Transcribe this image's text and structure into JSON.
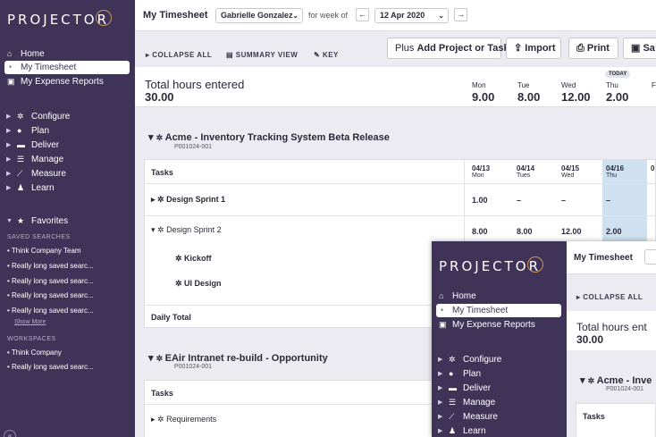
{
  "app": {
    "logo": "PROJECTOR"
  },
  "nav": {
    "home": "Home",
    "timesheet": "My Timesheet",
    "expense": "My Expense Reports",
    "configure": "Configure",
    "plan": "Plan",
    "deliver": "Deliver",
    "manage": "Manage",
    "measure": "Measure",
    "learn": "Learn",
    "favorites": "Favorites",
    "saved_searches_label": "SAVED SEARCHES",
    "saved": [
      "Think Company Team",
      "Really long saved searc...",
      "Really long saved searc...",
      "Really long saved searc...",
      "Really long saved searc...",
      "Really long saved searc..."
    ],
    "show_more": "Show More",
    "workspaces_label": "WORKSPACES",
    "workspaces": [
      "Think Company",
      "Really long saved searc..."
    ]
  },
  "header": {
    "title": "My Timesheet",
    "user": "Gabrielle Gonzalez",
    "week_label": "for week of",
    "week_value": "12 Apr 2020"
  },
  "toolbar": {
    "collapse_all": "COLLAPSE ALL",
    "summary_view": "SUMMARY VIEW",
    "key": "KEY",
    "add_prefix": "Plus",
    "add_label": "Add Project or Task",
    "import": "Import",
    "print": "Print",
    "save": "Sa"
  },
  "summary": {
    "total_label": "Total hours entered",
    "total_value": "30.00",
    "today_badge": "TODAY",
    "days": [
      {
        "day": "Mon",
        "value": "9.00"
      },
      {
        "day": "Tue",
        "value": "8.00"
      },
      {
        "day": "Wed",
        "value": "12.00"
      },
      {
        "day": "Thu",
        "value": "2.00"
      },
      {
        "day": "F",
        "value": ""
      }
    ]
  },
  "project1": {
    "name": "Acme - Inventory Tracking System Beta Release",
    "code": "P001024-001",
    "tasks_header": "Tasks",
    "cols": [
      {
        "date": "04/13",
        "day": "Mon"
      },
      {
        "date": "04/14",
        "day": "Tues"
      },
      {
        "date": "04/15",
        "day": "Wed"
      },
      {
        "date": "04/16",
        "day": "Thu"
      },
      {
        "date": "0",
        "day": ""
      }
    ],
    "rows": [
      {
        "name": "Design Sprint 1",
        "vals": [
          "1.00",
          "–",
          "–",
          "–"
        ]
      },
      {
        "name": "Design Sprint 2",
        "vals": [
          "8.00",
          "8.00",
          "12.00",
          "2.00"
        ]
      },
      {
        "name": "Kickoff",
        "vals": []
      },
      {
        "name": "UI Design",
        "vals": []
      }
    ],
    "daily_total": "Daily Total"
  },
  "project2": {
    "name": "EAir Intranet re-build - Opportunity",
    "code": "P001024-001",
    "tasks_header": "Tasks",
    "rows": [
      {
        "name": "Requirements"
      }
    ]
  },
  "overlay": {
    "logo": "PROJECTOR",
    "home": "Home",
    "timesheet": "My Timesheet",
    "expense": "My Expense Reports",
    "configure": "Configure",
    "plan": "Plan",
    "deliver": "Deliver",
    "manage": "Manage",
    "measure": "Measure",
    "learn": "Learn",
    "header_title": "My Timesheet",
    "collapse_all": "COLLAPSE ALL",
    "total_label": "Total hours ent",
    "total_value": "30.00",
    "project_name": "Acme - Inve",
    "project_code": "P001024-001",
    "tasks_header": "Tasks"
  },
  "colors": {
    "sidebar": "#3f3357",
    "today": "#cfe0f0",
    "accent": "#c9925a"
  }
}
